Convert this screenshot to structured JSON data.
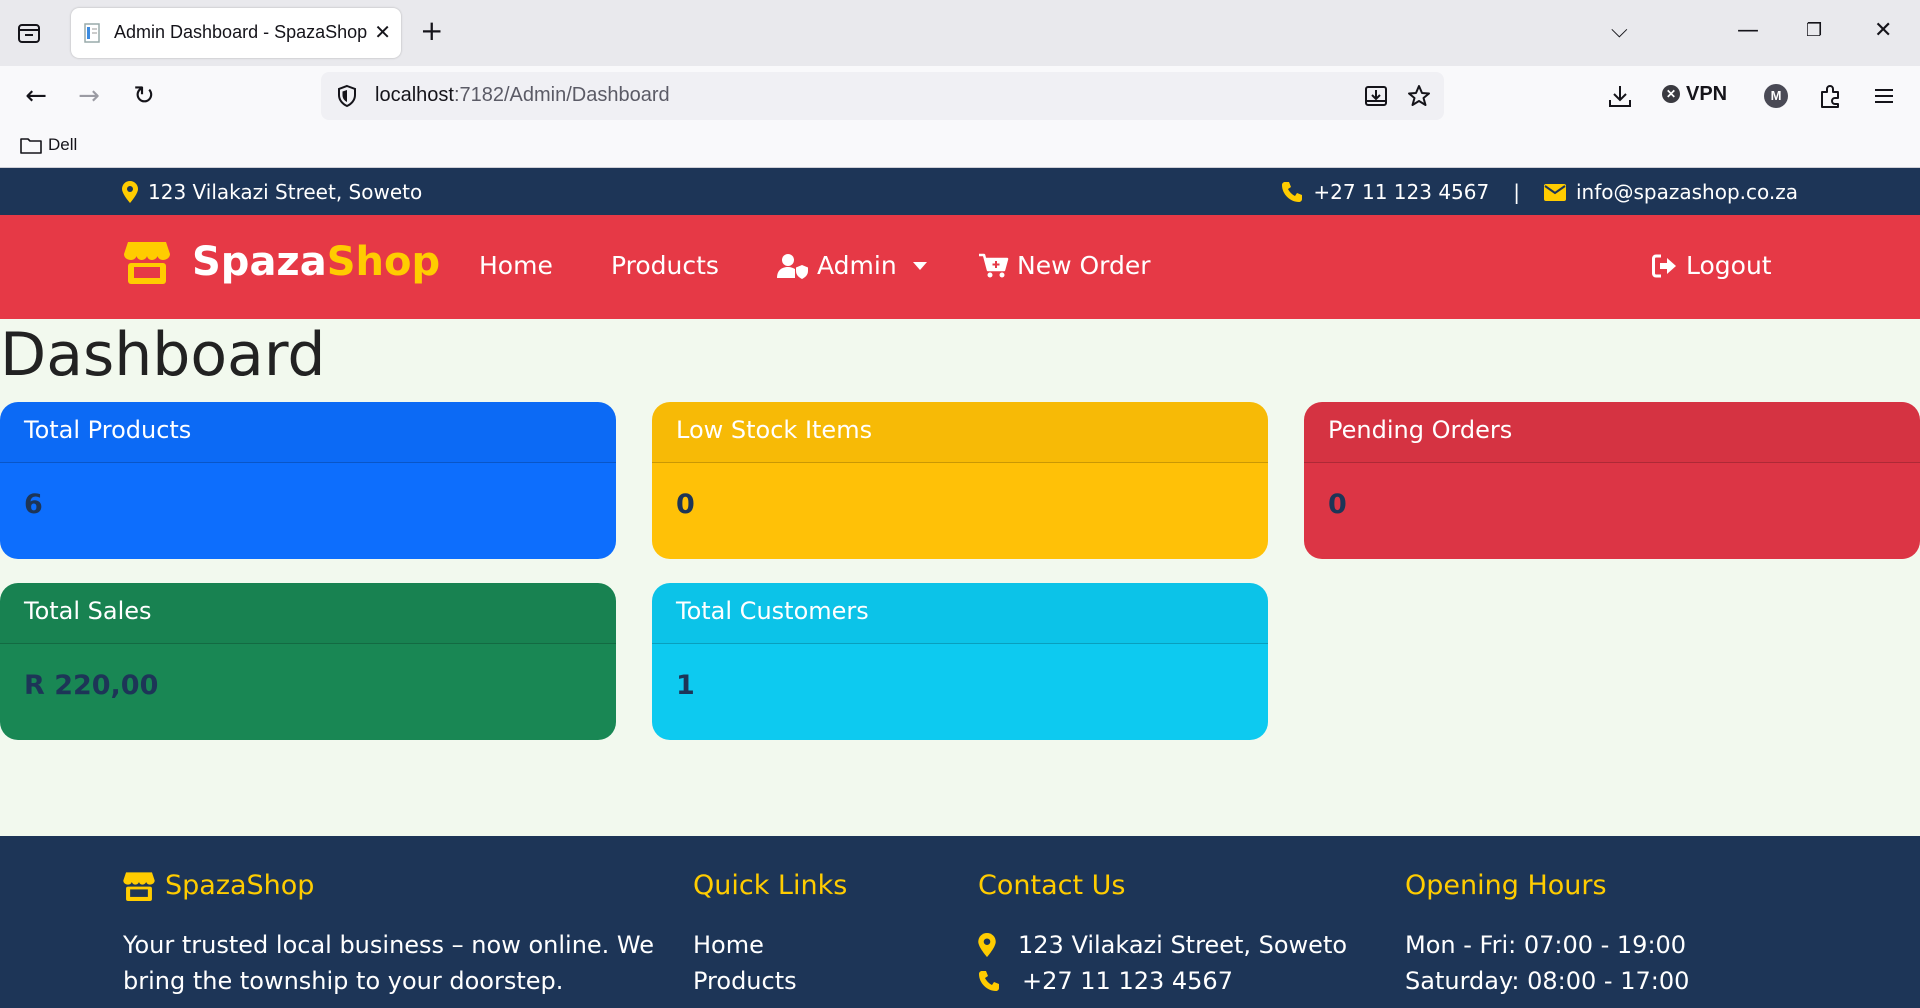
{
  "browser": {
    "tab_title": "Admin Dashboard - SpazaShop",
    "url_host": "localhost",
    "url_path": ":7182/Admin/Dashboard",
    "vpn_label": "VPN",
    "avatar_letter": "M",
    "bookmark": "Dell"
  },
  "topbar": {
    "address": "123 Vilakazi Street, Soweto",
    "phone": "+27 11 123 4567",
    "separator": "|",
    "email": "info@spazashop.co.za"
  },
  "nav": {
    "brand_part1": "Spaza",
    "brand_part2": "Shop",
    "links": [
      "Home",
      "Products",
      "Admin",
      "New Order"
    ],
    "logout": "Logout"
  },
  "dashboard": {
    "title": "Dashboard",
    "cards": [
      {
        "title": "Total Products",
        "value": "6",
        "color": "#0d6efd"
      },
      {
        "title": "Low Stock Items",
        "value": "0",
        "color": "#ffc107"
      },
      {
        "title": "Pending Orders",
        "value": "0",
        "color": "#dc3545"
      },
      {
        "title": "Total Sales",
        "value": "R 220,00",
        "color": "#198754"
      },
      {
        "title": "Total Customers",
        "value": "1",
        "color": "#0dcaf0"
      }
    ]
  },
  "footer": {
    "brand": "SpazaShop",
    "tagline_line1": "Your trusted local business – now online. We",
    "tagline_line2": "bring the township to your doorstep.",
    "quick_links_title": "Quick Links",
    "quick_links": [
      "Home",
      "Products"
    ],
    "contact_title": "Contact Us",
    "contact_address": "123 Vilakazi Street, Soweto",
    "contact_phone": "+27 11 123 4567",
    "hours_title": "Opening Hours",
    "hours": [
      "Mon - Fri: 07:00 - 19:00",
      "Saturday: 08:00 - 17:00"
    ]
  },
  "colors": {
    "navbar": "#e63946",
    "dark_blue": "#1d3557",
    "accent_yellow": "#ffcc00"
  }
}
